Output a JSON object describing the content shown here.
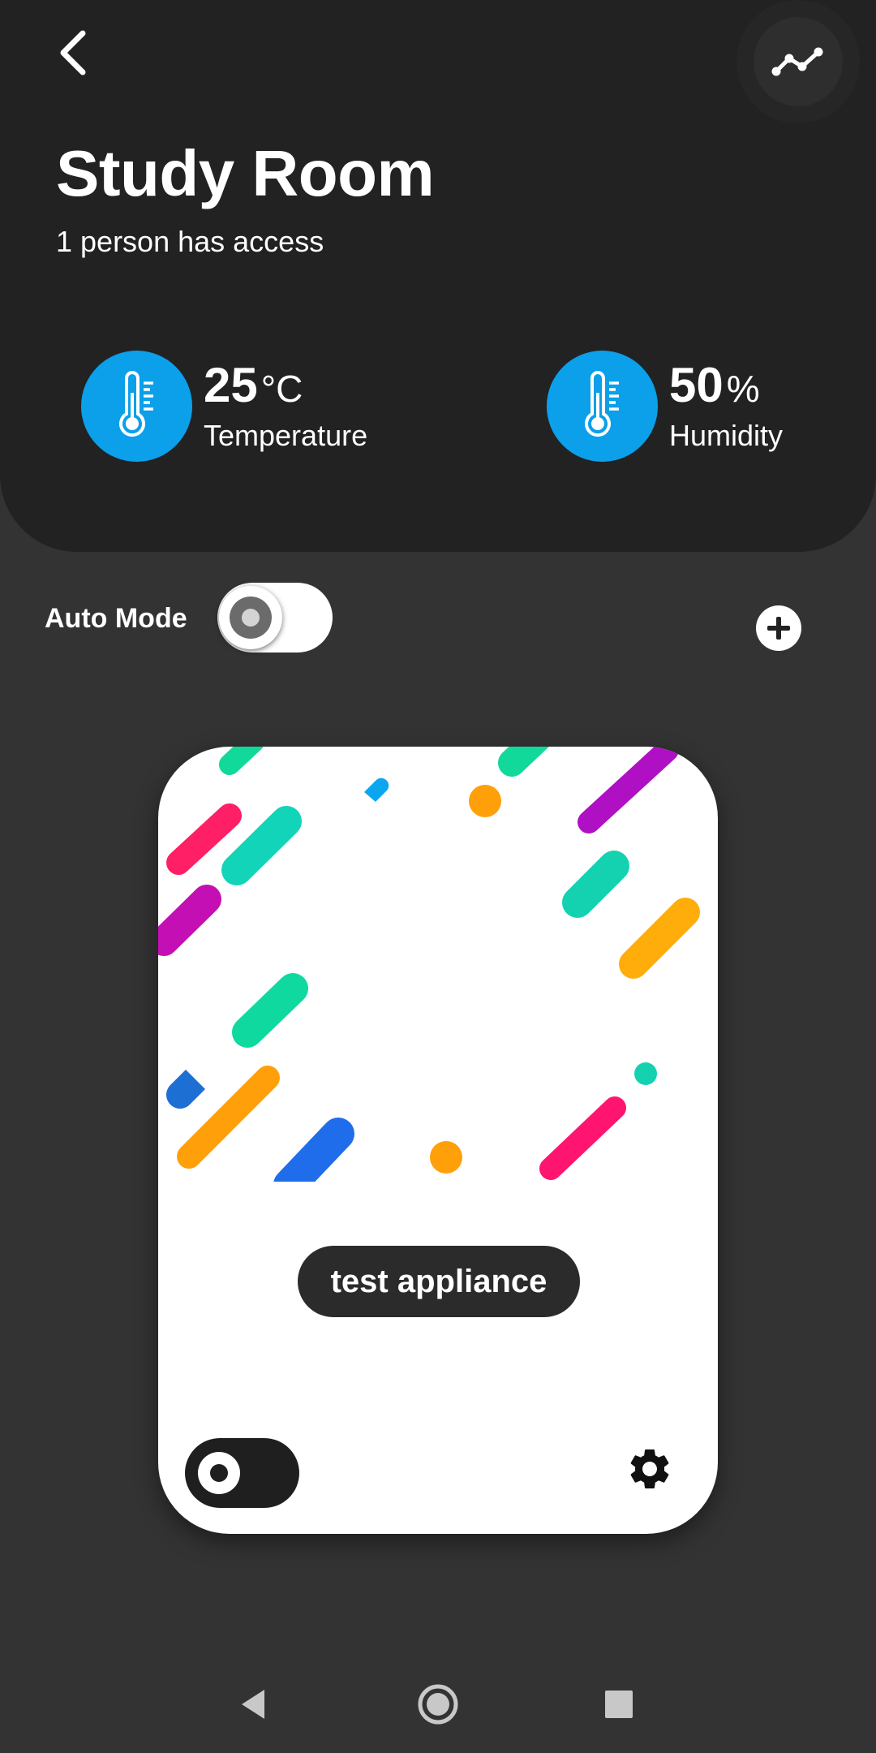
{
  "header": {
    "title": "Study Room",
    "subtitle": "1 person has access",
    "back_icon": "chevron-left-icon",
    "chart_icon": "line-chart-icon"
  },
  "stats": [
    {
      "value": "25",
      "unit": "°C",
      "label": "Temperature",
      "icon": "thermometer-icon",
      "color": "#0ba0e9"
    },
    {
      "value": "50",
      "unit": "%",
      "label": "Humidity",
      "icon": "thermometer-icon",
      "color": "#0ba0e9"
    }
  ],
  "controls": {
    "auto_mode_label": "Auto Mode",
    "auto_mode_on": false,
    "add_icon": "plus-circle-icon"
  },
  "appliance": {
    "name": "test appliance",
    "toggle_on": false,
    "settings_icon": "gear-icon"
  },
  "navbar": {
    "back_icon": "triangle-back-icon",
    "home_icon": "circle-home-icon",
    "recents_icon": "square-recents-icon"
  },
  "colors": {
    "background": "#333333",
    "header": "#222222",
    "accent": "#0ba0e9",
    "card": "#ffffff"
  }
}
